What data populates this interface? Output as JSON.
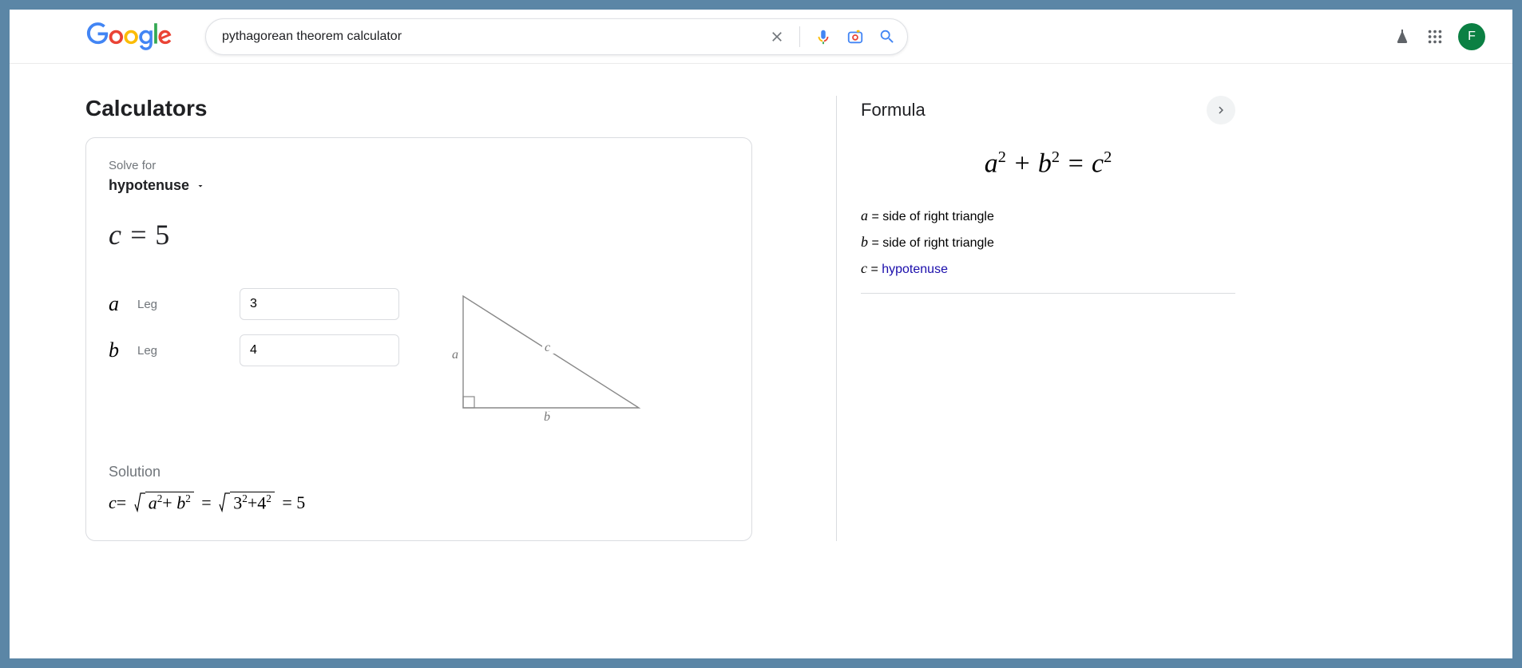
{
  "search": {
    "query": "pythagorean theorem calculator"
  },
  "avatar": {
    "letter": "F"
  },
  "calculators": {
    "section_title": "Calculators",
    "solve_for_label": "Solve for",
    "solve_for_value": "hypotenuse",
    "result_var": "c",
    "result_value": "5",
    "inputs": {
      "a": {
        "letter": "a",
        "label": "Leg",
        "value": "3"
      },
      "b": {
        "letter": "b",
        "label": "Leg",
        "value": "4"
      }
    },
    "triangle_labels": {
      "a": "a",
      "b": "b",
      "c": "c"
    },
    "solution_label": "Solution",
    "solution": {
      "var": "c",
      "a": "a",
      "b": "b",
      "av": "3",
      "bv": "4",
      "result": "5"
    }
  },
  "formula": {
    "title": "Formula",
    "legend": {
      "a": {
        "var": "a",
        "desc": "side of right triangle"
      },
      "b": {
        "var": "b",
        "desc": "side of right triangle"
      },
      "c": {
        "var": "c",
        "desc": "hypotenuse"
      }
    }
  }
}
